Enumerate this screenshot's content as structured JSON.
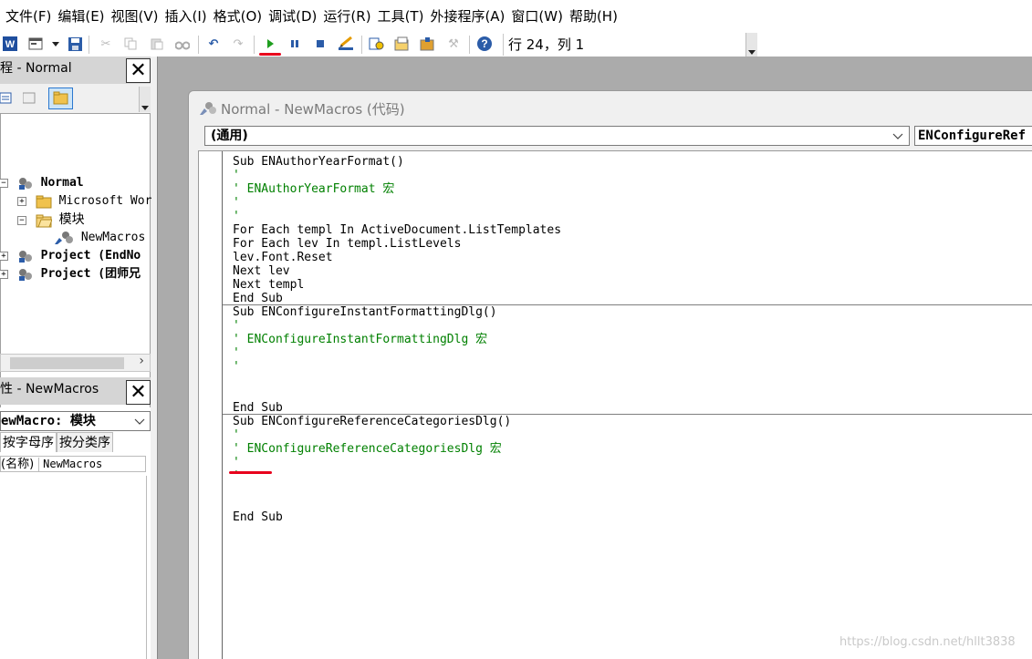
{
  "menu": {
    "file": "文件(F)",
    "edit": "编辑(E)",
    "view": "视图(V)",
    "insert": "插入(I)",
    "format": "格式(O)",
    "debug": "调试(D)",
    "run": "运行(R)",
    "tools": "工具(T)",
    "addins": "外接程序(A)",
    "window": "窗口(W)",
    "help": "帮助(H)"
  },
  "toolbar": {
    "position": "行 24，列 1",
    "icons": [
      "word-icon",
      "insert-userform-icon",
      "dropdown-icon",
      "save-icon",
      "cut-icon",
      "copy-icon",
      "paste-icon",
      "find-icon",
      "undo-icon",
      "redo-icon",
      "run-icon",
      "break-icon",
      "reset-icon",
      "design-mode-icon",
      "project-explorer-icon",
      "properties-icon",
      "object-browser-icon",
      "toolbox-icon",
      "help-icon"
    ]
  },
  "project_pane": {
    "title": "程 - Normal",
    "tree": [
      {
        "label": "Normal",
        "level": 0
      },
      {
        "label": "Microsoft Wor",
        "level": 1
      },
      {
        "label": "模块",
        "level": 1
      },
      {
        "label": "NewMacros",
        "level": 2
      },
      {
        "label": "Project (EndNo",
        "level": 0
      },
      {
        "label": "Project (团师兄",
        "level": 0
      }
    ]
  },
  "properties_pane": {
    "title": "性 - NewMacros",
    "object_select": "ewMacro: 模块",
    "tab_alpha": "按字母序",
    "tab_category": "按分类序",
    "row_name": "(名称)",
    "row_value": "NewMacros"
  },
  "code_window": {
    "title": "Normal - NewMacros (代码)",
    "object_combo": "(通用)",
    "procedure_combo": "ENConfigureRef",
    "lines": [
      {
        "text": "Sub ENAuthorYearFormat()",
        "comment": false
      },
      {
        "text": "'",
        "comment": true
      },
      {
        "text": "' ENAuthorYearFormat 宏",
        "comment": true
      },
      {
        "text": "'",
        "comment": true
      },
      {
        "text": "'",
        "comment": true
      },
      {
        "text": "For Each templ In ActiveDocument.ListTemplates",
        "comment": false
      },
      {
        "text": "For Each lev In templ.ListLevels",
        "comment": false
      },
      {
        "text": "lev.Font.Reset",
        "comment": false
      },
      {
        "text": "Next lev",
        "comment": false
      },
      {
        "text": "Next templ",
        "comment": false
      },
      {
        "text": "End Sub",
        "comment": false
      },
      {
        "text": "Sub ENConfigureInstantFormattingDlg()",
        "comment": false
      },
      {
        "text": "'",
        "comment": true
      },
      {
        "text": "' ENConfigureInstantFormattingDlg 宏",
        "comment": true
      },
      {
        "text": "'",
        "comment": true
      },
      {
        "text": "'",
        "comment": true
      },
      {
        "text": "",
        "comment": false
      },
      {
        "text": "",
        "comment": false
      },
      {
        "text": "End Sub",
        "comment": false
      },
      {
        "text": "Sub ENConfigureReferenceCategoriesDlg()",
        "comment": false
      },
      {
        "text": "'",
        "comment": true
      },
      {
        "text": "' ENConfigureReferenceCategoriesDlg 宏",
        "comment": true
      },
      {
        "text": "'",
        "comment": true
      },
      {
        "text": "'",
        "comment": true
      },
      {
        "text": "",
        "comment": false
      },
      {
        "text": "",
        "comment": false
      },
      {
        "text": "End Sub",
        "comment": false
      }
    ]
  },
  "colors": {
    "comment": "#008000",
    "annotation": "#e8001c",
    "run_icon": "#1e9e1e",
    "title_bar": "#d5d5d5"
  },
  "watermark": "https://blog.csdn.net/hllt3838"
}
